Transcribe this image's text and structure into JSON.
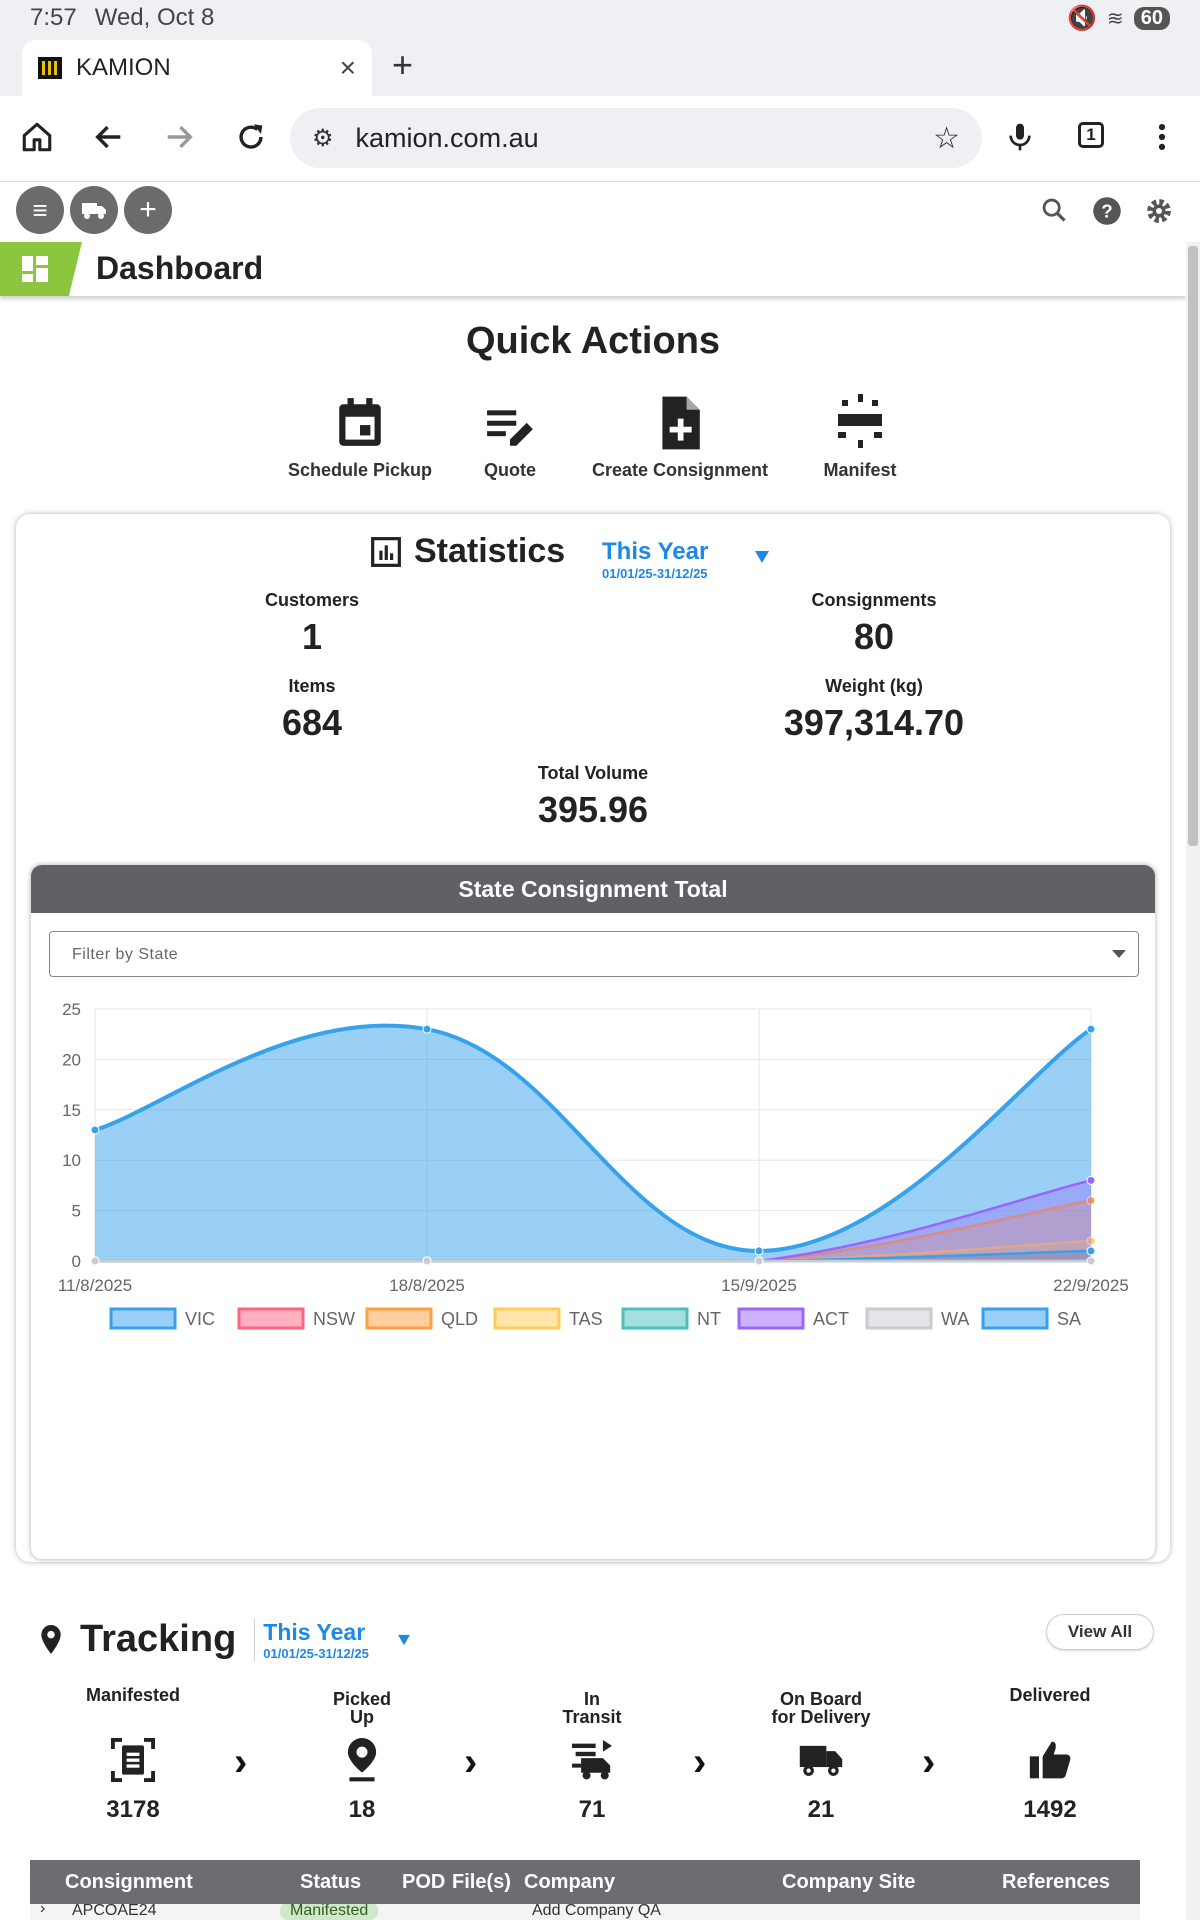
{
  "status_bar": {
    "time": "7:57",
    "date": "Wed, Oct 8",
    "battery": "60"
  },
  "browser": {
    "tab_title": "KAMION",
    "url": "kamion.com.au",
    "tab_count": "1"
  },
  "header": {
    "title": "Dashboard"
  },
  "quick_actions": {
    "title": "Quick Actions",
    "items": [
      {
        "label": "Schedule Pickup",
        "icon": "calendar-icon"
      },
      {
        "label": "Quote",
        "icon": "edit-list-icon"
      },
      {
        "label": "Create Consignment",
        "icon": "add-document-icon"
      },
      {
        "label": "Manifest",
        "icon": "manifest-icon"
      }
    ]
  },
  "statistics": {
    "title": "Statistics",
    "period_label": "This Year",
    "period_range": "01/01/25-31/12/25",
    "customers_label": "Customers",
    "customers_value": "1",
    "consignments_label": "Consignments",
    "consignments_value": "80",
    "items_label": "Items",
    "items_value": "684",
    "weight_label": "Weight (kg)",
    "weight_value": "397,314.70",
    "volume_label": "Total Volume",
    "volume_value": "395.96"
  },
  "state_chart": {
    "header": "State Consignment Total",
    "filter_placeholder": "Filter by State"
  },
  "chart_data": {
    "type": "area",
    "title": "State Consignment Total",
    "x": [
      "11/8/2025",
      "18/8/2025",
      "15/9/2025",
      "22/9/2025"
    ],
    "ylim": [
      0,
      25
    ],
    "yticks": [
      0,
      5,
      10,
      15,
      20,
      25
    ],
    "grid": true,
    "legend_position": "bottom",
    "series": [
      {
        "name": "VIC",
        "values": [
          13,
          23,
          1,
          23
        ],
        "color": "#36a2eb"
      },
      {
        "name": "NSW",
        "values": [
          0,
          0,
          0,
          1
        ],
        "color": "#ff6384"
      },
      {
        "name": "QLD",
        "values": [
          0,
          0,
          0,
          6
        ],
        "color": "#ff9f40"
      },
      {
        "name": "TAS",
        "values": [
          0,
          0,
          0,
          2
        ],
        "color": "#ffcd56"
      },
      {
        "name": "NT",
        "values": [
          0,
          0,
          0,
          0
        ],
        "color": "#4bc0c0"
      },
      {
        "name": "ACT",
        "values": [
          0,
          0,
          0,
          8
        ],
        "color": "#9966ff"
      },
      {
        "name": "WA",
        "values": [
          0,
          0,
          0,
          0
        ],
        "color": "#c9cbcf"
      },
      {
        "name": "SA",
        "values": [
          0,
          0,
          0,
          1
        ],
        "color": "#36a2eb"
      }
    ]
  },
  "tracking": {
    "title": "Tracking",
    "period_label": "This Year",
    "period_range": "01/01/25-31/12/25",
    "view_all": "View All",
    "stages": [
      {
        "label": "Manifested",
        "value": "3178",
        "icon": "manifest-doc-icon"
      },
      {
        "label": "Picked Up",
        "value": "18",
        "icon": "location-pin-icon"
      },
      {
        "label": "In Transit",
        "value": "71",
        "icon": "transit-icon"
      },
      {
        "label": "On Board for Delivery",
        "value": "21",
        "icon": "truck-icon"
      },
      {
        "label": "Delivered",
        "value": "1492",
        "icon": "thumbs-up-icon"
      }
    ]
  },
  "consignment_table": {
    "columns": [
      "Consignment",
      "Status",
      "POD",
      "File(s)",
      "Company",
      "Company Site",
      "References"
    ],
    "first_row": {
      "consignment": "APCOAE24",
      "status": "Manifested",
      "company": "Add Company QA"
    }
  }
}
